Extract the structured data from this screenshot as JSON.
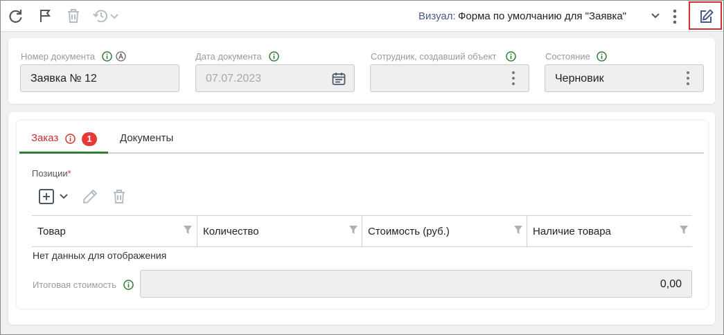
{
  "toolbar": {
    "icons": [
      "refresh-icon",
      "flag-icon",
      "trash-icon",
      "history-icon",
      "chevron-down-icon",
      "kebab-icon",
      "edit-icon"
    ],
    "visual_label": "Визуал:",
    "visual_value": "Форма по умолчанию для \"Заявка\""
  },
  "header_fields": {
    "doc_number": {
      "label": "Номер документа",
      "value": "Заявка № 12"
    },
    "doc_date": {
      "label": "Дата документа",
      "value": "07.07.2023"
    },
    "creator": {
      "label": "Сотрудник, создавший объект",
      "value": ""
    },
    "state": {
      "label": "Состояние",
      "value": "Черновик"
    }
  },
  "tabs": [
    {
      "label": "Заказ",
      "badge": "1",
      "active": true
    },
    {
      "label": "Документы",
      "active": false
    }
  ],
  "positions": {
    "label": "Позиции",
    "required_mark": "*",
    "columns": [
      "Товар",
      "Количество",
      "Стоимость (руб.)",
      "Наличие товара"
    ],
    "empty_text": "Нет данных для отображения"
  },
  "total": {
    "label": "Итоговая стоимость",
    "value": "0,00"
  },
  "colors": {
    "accent_green": "#2e7d32",
    "error_red": "#e53935",
    "highlight_border": "#d32f2f"
  }
}
